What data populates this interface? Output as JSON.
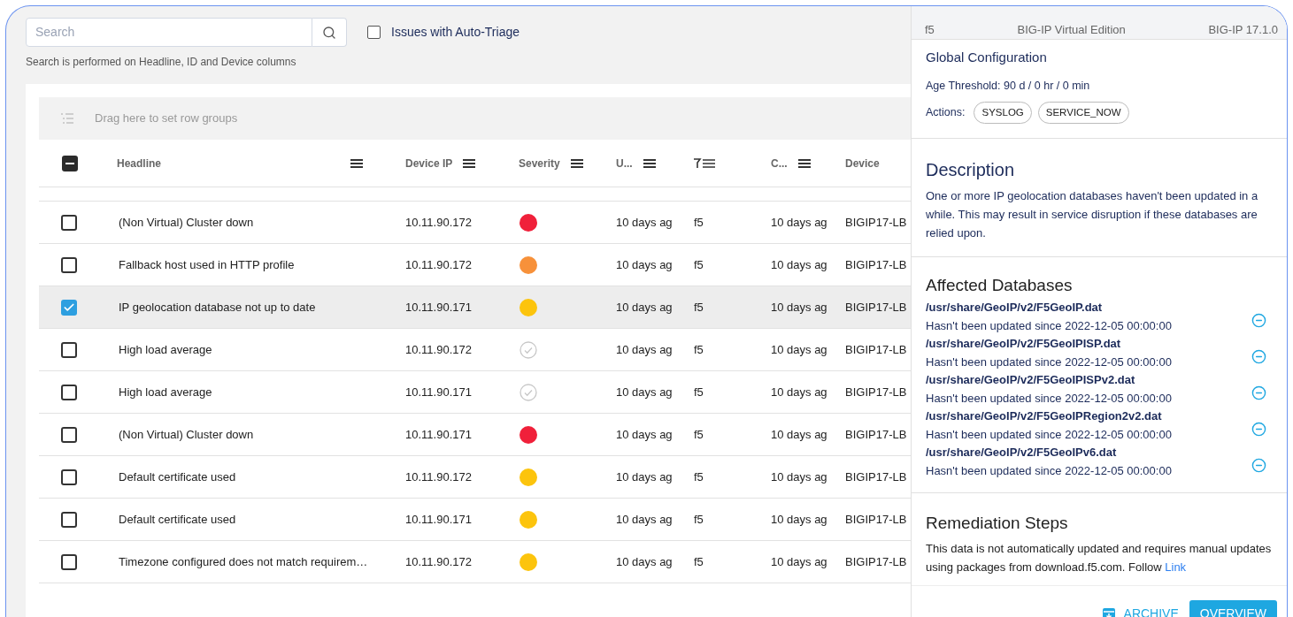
{
  "search": {
    "placeholder": "Search",
    "hint": "Search is performed on Headline, ID and Device columns"
  },
  "auto_triage": {
    "label": "Issues with Auto-Triage",
    "checked": false
  },
  "group_bar": {
    "placeholder": "Drag here to set row groups"
  },
  "table": {
    "select_all": {
      "indeterminate": true
    },
    "columns": [
      {
        "label": "Headline",
        "kind": "menu"
      },
      {
        "label": "Device IP",
        "kind": "menu"
      },
      {
        "label": "Severity",
        "kind": "menu"
      },
      {
        "label": "U...",
        "kind": "menu"
      },
      {
        "kind": "filter"
      },
      {
        "label": "C...",
        "kind": "menu"
      },
      {
        "label": "Device",
        "kind": "plain"
      }
    ],
    "rows": [
      {
        "selected": false,
        "headline": "(Non Virtual) Cluster down",
        "ip": "10.11.90.172",
        "kind": "critical",
        "updated": "10 days ag",
        "vendor": "f5",
        "created": "10 days ag",
        "device": "BIGIP17-LB"
      },
      {
        "selected": false,
        "headline": "Fallback host used in HTTP profile",
        "ip": "10.11.90.172",
        "kind": "high",
        "updated": "10 days ag",
        "vendor": "f5",
        "created": "10 days ag",
        "device": "BIGIP17-LB"
      },
      {
        "selected": true,
        "headline": "IP geolocation database not up to date",
        "ip": "10.11.90.171",
        "kind": "medium",
        "updated": "10 days ag",
        "vendor": "f5",
        "created": "10 days ag",
        "device": "BIGIP17-LB"
      },
      {
        "selected": false,
        "headline": "High load average",
        "ip": "10.11.90.172",
        "kind": "info",
        "updated": "10 days ag",
        "vendor": "f5",
        "created": "10 days ag",
        "device": "BIGIP17-LB"
      },
      {
        "selected": false,
        "headline": "High load average",
        "ip": "10.11.90.171",
        "kind": "info",
        "updated": "10 days ag",
        "vendor": "f5",
        "created": "10 days ag",
        "device": "BIGIP17-LB"
      },
      {
        "selected": false,
        "headline": "(Non Virtual) Cluster down",
        "ip": "10.11.90.171",
        "kind": "critical",
        "updated": "10 days ag",
        "vendor": "f5",
        "created": "10 days ag",
        "device": "BIGIP17-LB"
      },
      {
        "selected": false,
        "headline": "Default certificate used",
        "ip": "10.11.90.172",
        "kind": "medium",
        "updated": "10 days ag",
        "vendor": "f5",
        "created": "10 days ag",
        "device": "BIGIP17-LB"
      },
      {
        "selected": false,
        "headline": "Default certificate used",
        "ip": "10.11.90.171",
        "kind": "medium",
        "updated": "10 days ag",
        "vendor": "f5",
        "created": "10 days ag",
        "device": "BIGIP17-LB"
      },
      {
        "selected": false,
        "headline": "Timezone configured does not match requirem…",
        "ip": "10.11.90.172",
        "kind": "medium",
        "updated": "10 days ag",
        "vendor": "f5",
        "created": "10 days ag",
        "device": "BIGIP17-LB"
      }
    ]
  },
  "panel": {
    "device": [
      "f5",
      "BIG-IP Virtual Edition",
      "BIG-IP 17.1.0"
    ],
    "global_config": {
      "title": "Global Configuration",
      "threshold": "Age Threshold: 90 d / 0 hr / 0 min",
      "actions_label": "Actions:",
      "actions": [
        "SYSLOG",
        "SERVICE_NOW"
      ]
    },
    "description": {
      "title": "Description",
      "text": "One or more IP geolocation databases haven't been updated in a while. This may result in service disruption if these databases are relied upon."
    },
    "affected": {
      "title": "Affected Databases",
      "items": [
        {
          "path": "/usr/share/GeoIP/v2/F5GeoIP.dat",
          "note": "Hasn't been updated since 2022-12-05 00:00:00"
        },
        {
          "path": "/usr/share/GeoIP/v2/F5GeoIPISP.dat",
          "note": "Hasn't been updated since 2022-12-05 00:00:00"
        },
        {
          "path": "/usr/share/GeoIP/v2/F5GeoIPISPv2.dat",
          "note": "Hasn't been updated since 2022-12-05 00:00:00"
        },
        {
          "path": "/usr/share/GeoIP/v2/F5GeoIPRegion2v2.dat",
          "note": "Hasn't been updated since 2022-12-05 00:00:00"
        },
        {
          "path": "/usr/share/GeoIP/v2/F5GeoIPv6.dat",
          "note": "Hasn't been updated since 2022-12-05 00:00:00"
        }
      ]
    },
    "remediation": {
      "title": "Remediation Steps",
      "text": "This data is not automatically updated and requires manual updates using packages from download.f5.com. Follow",
      "link": "Link"
    },
    "buttons": {
      "archive": "ARCHIVE",
      "overview": "OVERVIEW"
    }
  }
}
